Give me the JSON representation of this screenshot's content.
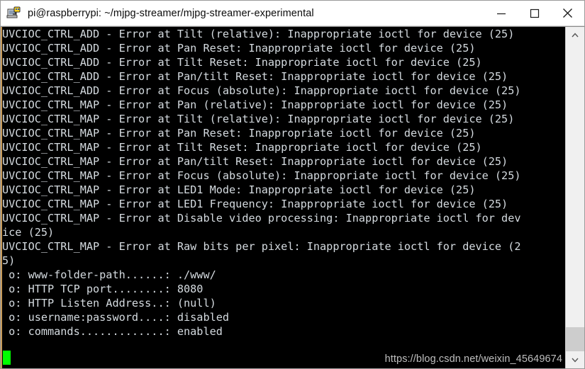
{
  "window": {
    "title": "pi@raspberrypi: ~/mjpg-streamer/mjpg-streamer-experimental",
    "icon": "putty-terminal-icon",
    "minimize_label": "—",
    "maximize_label": "☐",
    "close_label": "✕"
  },
  "terminal": {
    "background": "#000000",
    "foreground": "#d5dbe0",
    "cursor_color": "#00ff00",
    "lines": [
      "UVCIOC_CTRL_ADD - Error at Tilt (relative): Inappropriate ioctl for device (25)",
      "UVCIOC_CTRL_ADD - Error at Pan Reset: Inappropriate ioctl for device (25)",
      "UVCIOC_CTRL_ADD - Error at Tilt Reset: Inappropriate ioctl for device (25)",
      "UVCIOC_CTRL_ADD - Error at Pan/tilt Reset: Inappropriate ioctl for device (25)",
      "UVCIOC_CTRL_ADD - Error at Focus (absolute): Inappropriate ioctl for device (25)",
      "UVCIOC_CTRL_MAP - Error at Pan (relative): Inappropriate ioctl for device (25)",
      "UVCIOC_CTRL_MAP - Error at Tilt (relative): Inappropriate ioctl for device (25)",
      "UVCIOC_CTRL_MAP - Error at Pan Reset: Inappropriate ioctl for device (25)",
      "UVCIOC_CTRL_MAP - Error at Tilt Reset: Inappropriate ioctl for device (25)",
      "UVCIOC_CTRL_MAP - Error at Pan/tilt Reset: Inappropriate ioctl for device (25)",
      "UVCIOC_CTRL_MAP - Error at Focus (absolute): Inappropriate ioctl for device (25)",
      "UVCIOC_CTRL_MAP - Error at LED1 Mode: Inappropriate ioctl for device (25)",
      "UVCIOC_CTRL_MAP - Error at LED1 Frequency: Inappropriate ioctl for device (25)",
      "UVCIOC_CTRL_MAP - Error at Disable video processing: Inappropriate ioctl for dev",
      "ice (25)",
      "UVCIOC_CTRL_MAP - Error at Raw bits per pixel: Inappropriate ioctl for device (2",
      "5)",
      " o: www-folder-path......: ./www/",
      " o: HTTP TCP port........: 8080",
      " o: HTTP Listen Address..: (null)",
      " o: username:password....: disabled",
      " o: commands.............: enabled",
      "",
      ""
    ],
    "watermark": "https://blog.csdn.net/weixin_45649674"
  },
  "scrollbar": {
    "up_arrow": "chevron-up",
    "down_arrow": "chevron-down"
  }
}
